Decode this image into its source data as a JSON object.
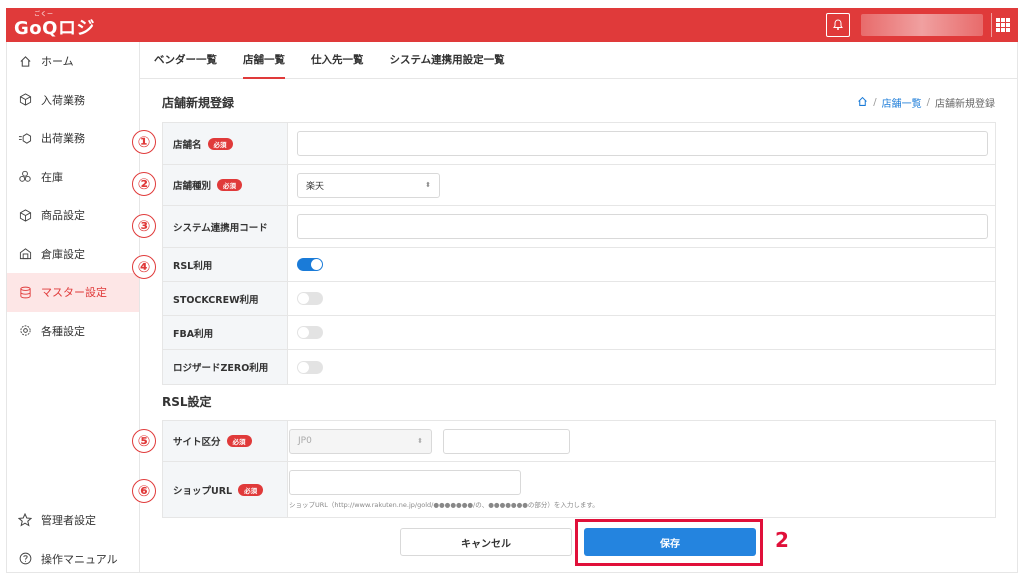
{
  "app": {
    "logo": "GoQロジ",
    "logo_ruby": "ごくー"
  },
  "colors": {
    "brand": "#e03a3a",
    "primary": "#2484df",
    "highlight": "#e0103a"
  },
  "sidebar": {
    "items": [
      {
        "label": "ホーム",
        "icon": "home-icon"
      },
      {
        "label": "入荷業務",
        "icon": "inbound-icon"
      },
      {
        "label": "出荷業務",
        "icon": "outbound-icon"
      },
      {
        "label": "在庫",
        "icon": "inventory-icon"
      },
      {
        "label": "商品設定",
        "icon": "box-icon"
      },
      {
        "label": "倉庫設定",
        "icon": "warehouse-icon"
      },
      {
        "label": "マスター設定",
        "icon": "database-icon"
      },
      {
        "label": "各種設定",
        "icon": "gear-icon"
      }
    ],
    "bottom": [
      {
        "label": "管理者設定",
        "icon": "star-icon"
      },
      {
        "label": "操作マニュアル",
        "icon": "help-icon"
      }
    ]
  },
  "tabs": [
    "ベンダー一覧",
    "店舗一覧",
    "仕入先一覧",
    "システム連携用設定一覧"
  ],
  "page": {
    "title": "店舗新規登録",
    "breadcrumb": {
      "link": "店舗一覧",
      "sep": "/",
      "current": "店舗新規登録"
    }
  },
  "required_badge": "必須",
  "form": {
    "store_name": {
      "label": "店舗名",
      "value": ""
    },
    "store_type": {
      "label": "店舗種別",
      "value": "楽天"
    },
    "system_code": {
      "label": "システム連携用コード",
      "value": ""
    },
    "rsl": {
      "label": "RSL利用",
      "enabled": true
    },
    "stockcrew": {
      "label": "STOCKCREW利用",
      "enabled": false
    },
    "fba": {
      "label": "FBA利用",
      "enabled": false
    },
    "logizard": {
      "label": "ロジザードZERO利用",
      "enabled": false
    }
  },
  "rsl_settings": {
    "title": "RSL設定",
    "site_type": {
      "label": "サイト区分",
      "value": "JP0"
    },
    "shop_url": {
      "label": "ショップURL",
      "hint": "ショップURL（http://www.rakuten.ne.jp/gold/●●●●●●●/の、●●●●●●●の部分）を入力します。"
    }
  },
  "annotations": [
    "①",
    "②",
    "③",
    "④",
    "⑤",
    "⑥"
  ],
  "buttons": {
    "cancel": "キャンセル",
    "save": "保存"
  },
  "step_label": "2"
}
